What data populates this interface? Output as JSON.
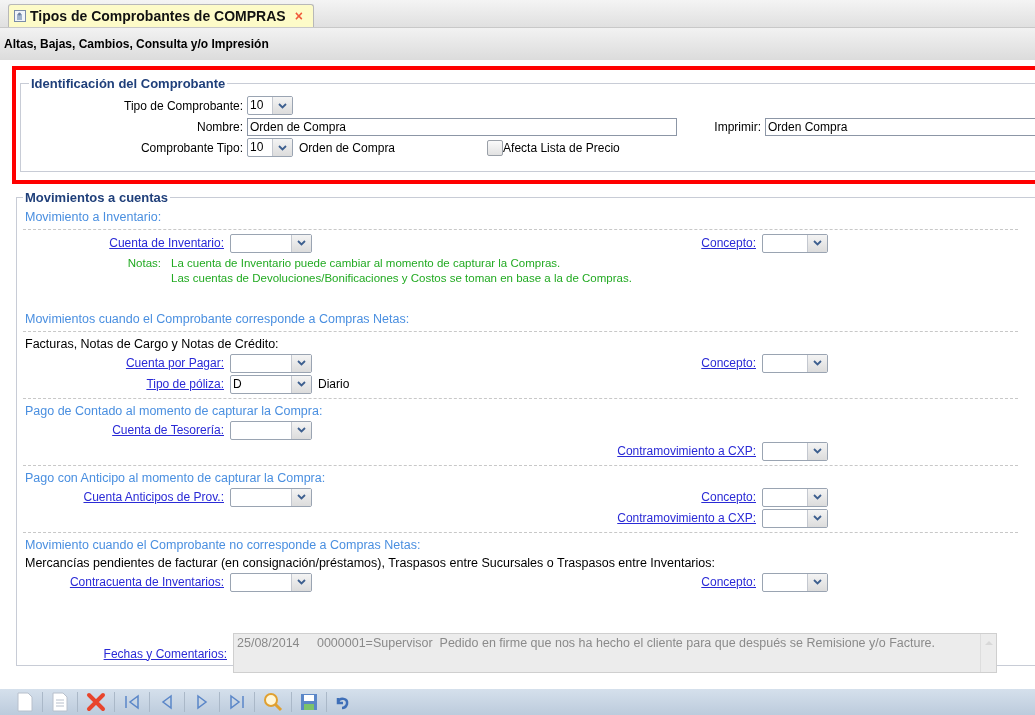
{
  "tab": {
    "title": "Tipos de Comprobantes de COMPRAS",
    "close": "×",
    "selected": true
  },
  "subtitle": "Altas, Bajas, Cambios, Consulta y/o Impresión",
  "identification": {
    "legend": "Identificación del Comprobante",
    "tipo": {
      "label": "Tipo de Comprobante:",
      "value": "10"
    },
    "nombre": {
      "label": "Nombre:",
      "value": "Orden de Compra"
    },
    "comprobante_tipo": {
      "label": "Comprobante Tipo:",
      "value": "10",
      "description": "Orden de Compra"
    },
    "imprimir": {
      "label": "Imprimir:",
      "value": "Orden Compra"
    },
    "afecta": {
      "label": "Afecta Lista de Precio",
      "checked": false
    }
  },
  "movements": {
    "legend": "Movimientos a cuentas",
    "items": [
      {
        "kind": "heading",
        "text": "Movimiento a Inventario:"
      },
      {
        "kind": "divider"
      },
      {
        "kind": "field",
        "left": {
          "label": "Cuenta de Inventario:"
        },
        "right": {
          "label": "Concepto:"
        }
      },
      {
        "kind": "notes",
        "label": "Notas:",
        "lines": [
          "La cuenta de Inventario puede cambiar al momento de capturar la Compras.",
          "Las cuentas de Devoluciones/Bonificaciones y Costos se toman en base a la de Compras."
        ]
      },
      {
        "kind": "heading",
        "text": "Movimientos cuando el Comprobante corresponde a Compras Netas:"
      },
      {
        "kind": "divider"
      },
      {
        "kind": "text",
        "text": "Facturas, Notas de Cargo y Notas de Crédito:"
      },
      {
        "kind": "field",
        "left": {
          "label": "Cuenta por Pagar:"
        },
        "right": {
          "label": "Concepto:"
        }
      },
      {
        "kind": "field",
        "left": {
          "label": "Tipo de póliza:",
          "value": "D",
          "suffix": "Diario"
        }
      },
      {
        "kind": "divider"
      },
      {
        "kind": "heading",
        "text": "Pago de Contado al momento de capturar la Compra:"
      },
      {
        "kind": "field",
        "left": {
          "label": "Cuenta de Tesorería:"
        }
      },
      {
        "kind": "field",
        "right": {
          "label": "Contramovimiento a CXP:"
        }
      },
      {
        "kind": "divider"
      },
      {
        "kind": "heading",
        "text": "Pago con Anticipo al momento de capturar la Compra:"
      },
      {
        "kind": "field",
        "left": {
          "label": "Cuenta Anticipos de Prov.:"
        },
        "right": {
          "label": "Concepto:"
        }
      },
      {
        "kind": "field",
        "right": {
          "label": "Contramovimiento a CXP:"
        }
      },
      {
        "kind": "divider"
      },
      {
        "kind": "heading",
        "text": "Movimiento cuando el Comprobante no corresponde a Compras Netas:"
      },
      {
        "kind": "text",
        "text": "Mercancías pendientes de facturar (en consignación/préstamos), Traspasos entre Sucursales o Traspasos entre Inventarios:"
      },
      {
        "kind": "field",
        "left": {
          "label": "Contracuenta de Inventarios:"
        },
        "right": {
          "label": "Concepto:"
        }
      }
    ],
    "comments": {
      "label": "Fechas y Comentarios:",
      "value": "25/08/2014     0000001=Supervisor  Pedido en firme que nos ha hecho el cliente para que después se Remisione y/o Facture.",
      "disabled": true
    }
  }
}
